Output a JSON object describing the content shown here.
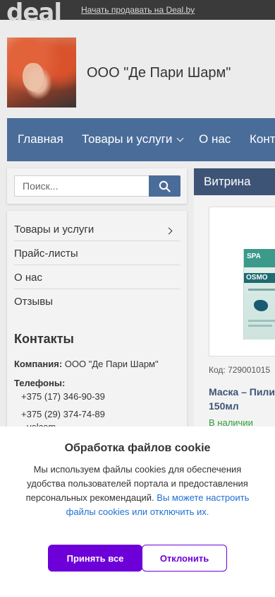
{
  "topbar": {
    "logo": "deal",
    "sell_link": "Начать продавать на Deal.by"
  },
  "header": {
    "company_title": "ООО \"Де Пари Шарм\""
  },
  "nav": {
    "items": [
      {
        "label": "Главная"
      },
      {
        "label": "Товары и услуги"
      },
      {
        "label": "О нас"
      },
      {
        "label": "Конта"
      }
    ]
  },
  "search": {
    "placeholder": "Поиск..."
  },
  "sidebar": {
    "menu": [
      {
        "label": "Товары и услуги"
      },
      {
        "label": "Прайс-листы"
      },
      {
        "label": "О нас"
      },
      {
        "label": "Отзывы"
      }
    ],
    "contacts_heading": "Контакты",
    "company_label": "Компания:",
    "company_value": "ООО \"Де Пари Шарм\"",
    "phones_label": "Телефоны:",
    "phones": [
      "+375 (17) 346-90-39",
      "+375 (29) 374-74-89",
      "velcom"
    ]
  },
  "showcase": {
    "tab_label": "Витрина",
    "product": {
      "box_brand": "SPA",
      "box_name": "OSMO",
      "code": "Код: 729001015",
      "name": "Маска – Пили 150мл",
      "stock": "В наличии"
    }
  },
  "cookie": {
    "title": "Обработка файлов cookie",
    "text": "Мы используем файлы cookies для обеспечения удобства пользователей портала и предоставления персональных рекомендаций.",
    "link": "Вы можете настроить файлы cookies или отключить их.",
    "accept": "Принять все",
    "decline": "Отклонить"
  },
  "colors": {
    "nav_bg": "#4a6c99",
    "tab_bg": "#3d5476",
    "accent": "#6d00d9",
    "link": "#1e6fd6",
    "stock": "#2e9e3a"
  }
}
